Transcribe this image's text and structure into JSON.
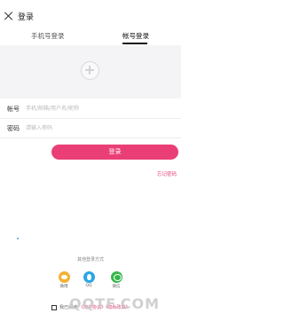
{
  "header": {
    "title": "登录",
    "close_icon": "close-icon"
  },
  "tabs": [
    {
      "label": "手机号登录",
      "active": false
    },
    {
      "label": "帐号登录",
      "active": true
    }
  ],
  "logo": {
    "icon": "app-logo-icon"
  },
  "form": {
    "account": {
      "label": "帐号",
      "placeholder": "手机/邮箱/用户名/昵称",
      "value": ""
    },
    "password": {
      "label": "密码",
      "placeholder": "请输入密码",
      "value": ""
    }
  },
  "login_button": {
    "label": "登录",
    "color": "#ea3f76"
  },
  "forgot_link": "忘记密码",
  "third_party": {
    "label": "其他登录方式",
    "items": [
      {
        "label": "微博",
        "icon": "weibo-icon",
        "color": "#f2b233"
      },
      {
        "label": "QQ",
        "icon": "qq-icon",
        "color": "#2aa6e6"
      },
      {
        "label": "微信",
        "icon": "wechat-icon",
        "color": "#35b74a"
      }
    ]
  },
  "agreement": {
    "prefix": "我已阅读",
    "link": "《用户协议》《隐私政策》",
    "checked": false
  },
  "watermark": "QQTF.COM"
}
